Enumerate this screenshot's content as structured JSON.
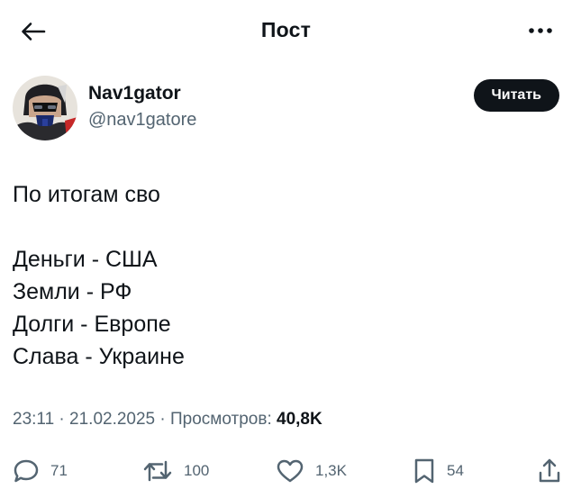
{
  "header": {
    "title": "Пост",
    "back_icon": "arrow-left-icon",
    "more_icon": "more-horizontal-icon"
  },
  "author": {
    "display_name": "Nav1gator",
    "handle": "@nav1gatore",
    "follow_label": "Читать"
  },
  "tweet": {
    "lines": [
      "По итогам сво",
      "",
      "Деньги - США",
      "Земли - РФ",
      "Долги - Европе",
      "Слава - Украине"
    ]
  },
  "meta": {
    "time": "23:11",
    "separator": "·",
    "date": "21.02.2025",
    "views_label": "Просмотров:",
    "views_count": "40,8K"
  },
  "actions": {
    "replies": "71",
    "reposts": "100",
    "likes": "1,3K",
    "bookmarks": "54"
  },
  "colors": {
    "text_primary": "#0f1419",
    "text_secondary": "#536471",
    "button_bg": "#0f1419",
    "button_text": "#ffffff"
  }
}
